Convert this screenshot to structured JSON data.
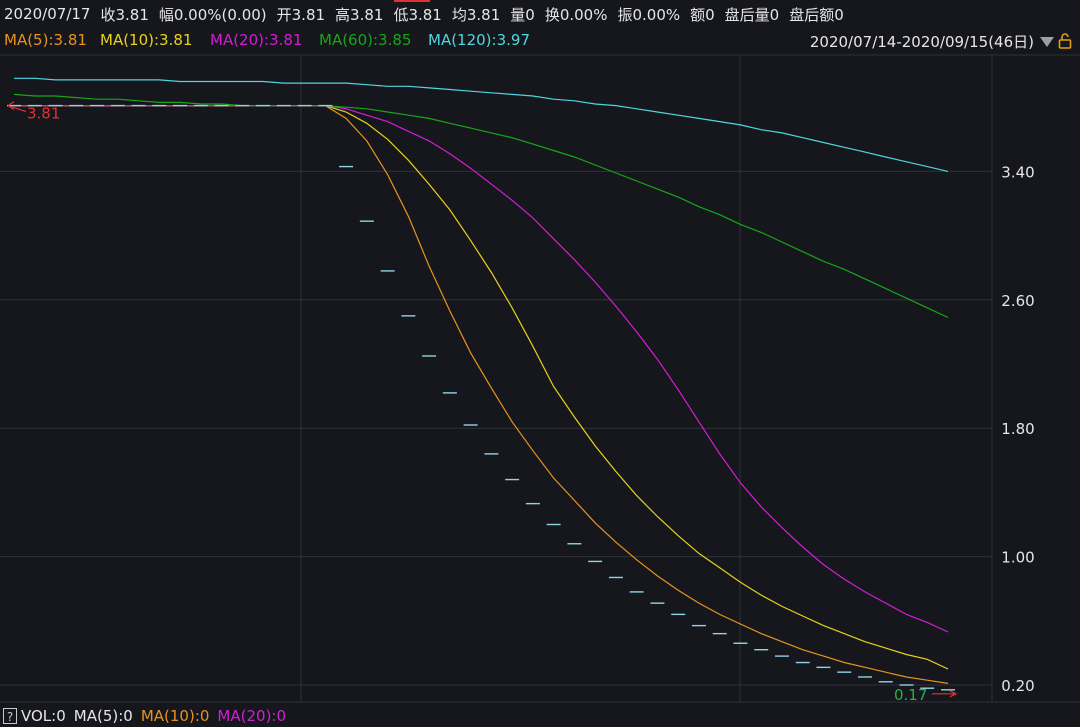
{
  "info": {
    "date": "2020/07/17",
    "close": "收3.81",
    "change": "幅0.00%(0.00)",
    "open": "开3.81",
    "high": "高3.81",
    "low": "低3.81",
    "avg": "均3.81",
    "volume": "量0",
    "turnover": "换0.00%",
    "amplitude": "振0.00%",
    "amount": "额0",
    "after_volume": "盘后量0",
    "after_amount": "盘后额0"
  },
  "ma_legend": [
    {
      "label": "MA(5):3.81",
      "color": "#e8921e"
    },
    {
      "label": "MA(10):3.81",
      "color": "#e6d21a"
    },
    {
      "label": "MA(20):3.81",
      "color": "#d21ed2"
    },
    {
      "label": "MA(60):3.85",
      "color": "#17a617"
    },
    {
      "label": "MA(120):3.97",
      "color": "#4fd6e0"
    }
  ],
  "range": {
    "label": "2020/07/14-2020/09/15(46日)"
  },
  "markers": {
    "top_price": "3.81",
    "bottom_price": "0.17"
  },
  "colors": {
    "background": "#16171d",
    "grid": "#2e323a",
    "price": "#8fd3e6",
    "red": "#e03030",
    "green": "#22b14c"
  },
  "icons": {
    "lock": "lock-open-icon",
    "dropdown": "triangle-down-icon",
    "help": "question-icon"
  },
  "volume_bar": {
    "help": "?",
    "items": [
      {
        "label": "VOL:0",
        "color": "#e6e6e6"
      },
      {
        "label": "MA(5):0",
        "color": "#e6e6e6"
      },
      {
        "label": "MA(10):0",
        "color": "#e8921e"
      },
      {
        "label": "MA(20):0",
        "color": "#d21ed2"
      }
    ]
  },
  "chart_data": {
    "type": "line",
    "ylim": [
      0.0,
      4.2
    ],
    "y_ticks": [
      "3.40",
      "2.60",
      "1.80",
      "1.00",
      "0.20"
    ],
    "y_tick_values": [
      3.4,
      2.6,
      1.8,
      1.0,
      0.2
    ],
    "x": [
      1,
      2,
      3,
      4,
      5,
      6,
      7,
      8,
      9,
      10,
      11,
      12,
      13,
      14,
      15,
      16,
      17,
      18,
      19,
      20,
      21,
      22,
      23,
      24,
      25,
      26,
      27,
      28,
      29,
      30,
      31,
      32,
      33,
      34,
      35,
      36,
      37,
      38,
      39,
      40,
      41,
      42,
      43,
      44,
      45,
      46
    ],
    "price": [
      3.81,
      3.81,
      3.81,
      3.81,
      3.81,
      3.81,
      3.81,
      3.81,
      3.81,
      3.81,
      3.81,
      3.81,
      3.81,
      3.81,
      3.81,
      3.81,
      3.43,
      3.09,
      2.78,
      2.5,
      2.25,
      2.02,
      1.82,
      1.64,
      1.48,
      1.33,
      1.2,
      1.08,
      0.97,
      0.87,
      0.78,
      0.71,
      0.64,
      0.57,
      0.52,
      0.46,
      0.42,
      0.38,
      0.34,
      0.31,
      0.28,
      0.25,
      0.22,
      0.2,
      0.18,
      0.17
    ],
    "series": [
      {
        "name": "MA(5)",
        "color": "#e8921e",
        "values": [
          3.81,
          3.81,
          3.81,
          3.81,
          3.81,
          3.81,
          3.81,
          3.81,
          3.81,
          3.81,
          3.81,
          3.81,
          3.81,
          3.81,
          3.81,
          3.81,
          3.73,
          3.59,
          3.38,
          3.12,
          2.81,
          2.53,
          2.27,
          2.05,
          1.84,
          1.66,
          1.49,
          1.35,
          1.21,
          1.09,
          0.98,
          0.88,
          0.79,
          0.71,
          0.64,
          0.58,
          0.52,
          0.47,
          0.42,
          0.38,
          0.34,
          0.31,
          0.28,
          0.25,
          0.23,
          0.21
        ]
      },
      {
        "name": "MA(10)",
        "color": "#e6d21a",
        "values": [
          3.81,
          3.81,
          3.81,
          3.81,
          3.81,
          3.81,
          3.81,
          3.81,
          3.81,
          3.81,
          3.81,
          3.81,
          3.81,
          3.81,
          3.81,
          3.81,
          3.77,
          3.7,
          3.6,
          3.47,
          3.32,
          3.16,
          2.97,
          2.77,
          2.55,
          2.31,
          2.06,
          1.87,
          1.69,
          1.53,
          1.38,
          1.25,
          1.13,
          1.02,
          0.93,
          0.84,
          0.76,
          0.69,
          0.63,
          0.57,
          0.52,
          0.47,
          0.43,
          0.39,
          0.36,
          0.3
        ]
      },
      {
        "name": "MA(20)",
        "color": "#d21ed2",
        "values": [
          3.81,
          3.81,
          3.81,
          3.81,
          3.81,
          3.81,
          3.81,
          3.81,
          3.81,
          3.81,
          3.81,
          3.81,
          3.81,
          3.81,
          3.81,
          3.81,
          3.79,
          3.75,
          3.71,
          3.65,
          3.59,
          3.51,
          3.42,
          3.32,
          3.22,
          3.11,
          2.98,
          2.85,
          2.71,
          2.56,
          2.4,
          2.23,
          2.04,
          1.84,
          1.64,
          1.46,
          1.31,
          1.18,
          1.06,
          0.95,
          0.86,
          0.78,
          0.71,
          0.64,
          0.59,
          0.53
        ]
      },
      {
        "name": "MA(60)",
        "color": "#17a617",
        "values": [
          3.88,
          3.87,
          3.87,
          3.86,
          3.85,
          3.85,
          3.84,
          3.83,
          3.83,
          3.82,
          3.82,
          3.81,
          3.81,
          3.81,
          3.81,
          3.81,
          3.8,
          3.79,
          3.77,
          3.75,
          3.73,
          3.7,
          3.67,
          3.64,
          3.61,
          3.57,
          3.53,
          3.49,
          3.44,
          3.39,
          3.34,
          3.29,
          3.24,
          3.18,
          3.13,
          3.07,
          3.02,
          2.96,
          2.9,
          2.84,
          2.79,
          2.73,
          2.67,
          2.61,
          2.55,
          2.49
        ]
      },
      {
        "name": "MA(120)",
        "color": "#4fd6e0",
        "values": [
          3.98,
          3.98,
          3.97,
          3.97,
          3.97,
          3.97,
          3.97,
          3.97,
          3.96,
          3.96,
          3.96,
          3.96,
          3.96,
          3.95,
          3.95,
          3.95,
          3.95,
          3.94,
          3.93,
          3.93,
          3.92,
          3.91,
          3.9,
          3.89,
          3.88,
          3.87,
          3.85,
          3.84,
          3.82,
          3.81,
          3.79,
          3.77,
          3.75,
          3.73,
          3.71,
          3.69,
          3.66,
          3.64,
          3.61,
          3.58,
          3.55,
          3.52,
          3.49,
          3.46,
          3.43,
          3.4
        ]
      }
    ]
  }
}
